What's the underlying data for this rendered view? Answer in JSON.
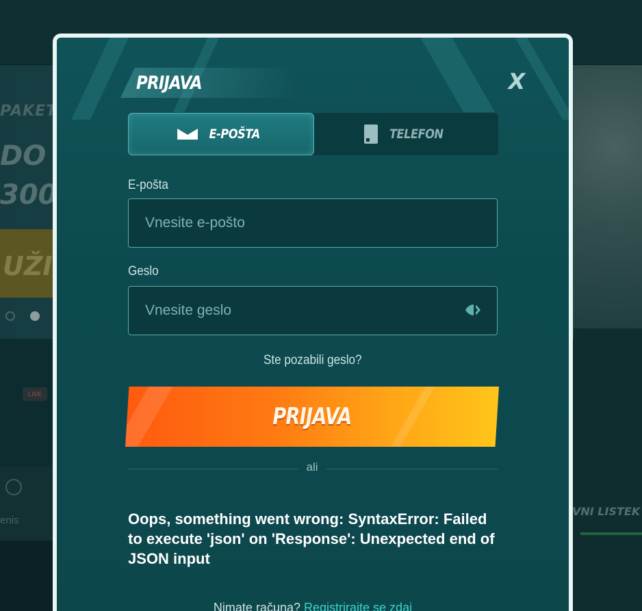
{
  "background": {
    "banner_line1": "PAKET D",
    "banner_line2": "DO",
    "banner_line3": "300",
    "banner_cta": "UŽI",
    "live_badge": "LIVE",
    "sport_label": "enis",
    "slip_label": "VNI LISTEK ("
  },
  "modal": {
    "title": "PRIJAVA",
    "close_label": "X",
    "tabs": [
      {
        "label": "E-POŠTA",
        "icon": "envelope-icon",
        "active": true
      },
      {
        "label": "TELEFON",
        "icon": "phone-icon",
        "active": false
      }
    ],
    "email": {
      "label": "E-pošta",
      "placeholder": "Vnesite e-pošto"
    },
    "password": {
      "label": "Geslo",
      "placeholder": "Vnesite geslo",
      "toggle_icon": "eye-off-icon"
    },
    "forgot_link": "Ste pozabili geslo?",
    "login_button": "PRIJAVA",
    "or_text": "ali",
    "error_message": "Oops, something went wrong: SyntaxError: Failed to execute 'json' on 'Response': Unexpected end of JSON input",
    "register": {
      "prompt": "Nimate računa?",
      "link": "Registrirajte se zdaj"
    }
  },
  "colors": {
    "modal_bg": "#0d4b50",
    "accent_teal": "#3fd1c9",
    "button_orange": "#ff7a12",
    "button_yellow": "#ffc51a"
  }
}
